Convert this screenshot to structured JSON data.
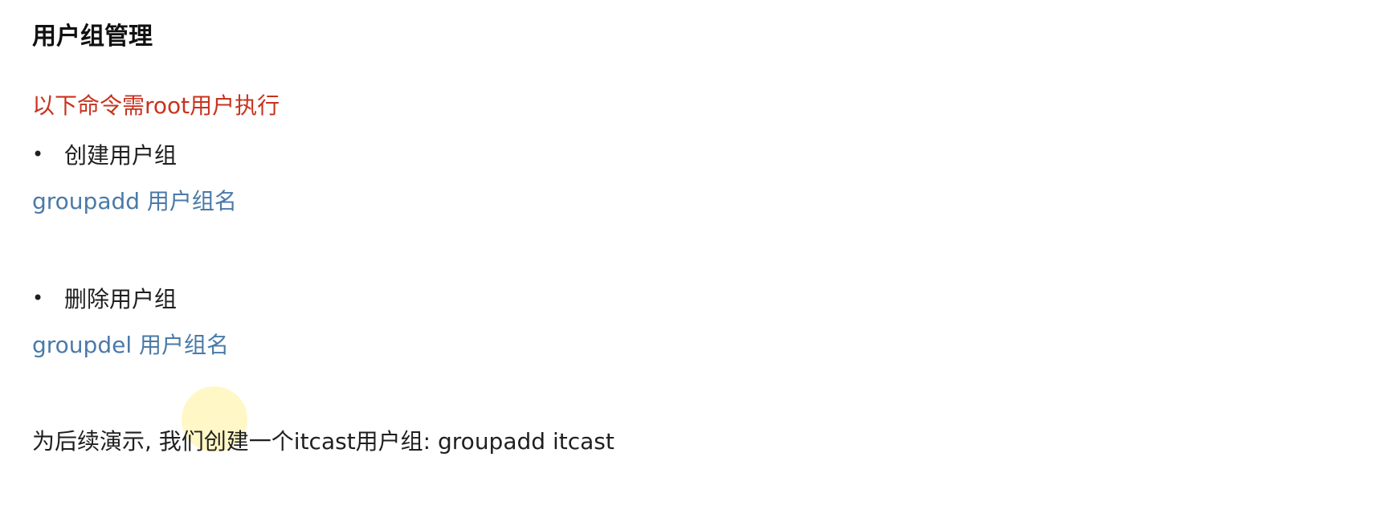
{
  "document": {
    "title": "用户组管理",
    "note": "以下命令需root用户执行",
    "sections": [
      {
        "bullet_icon": "bullet-dot",
        "heading": "创建用户组",
        "command": "groupadd 用户组名"
      },
      {
        "bullet_icon": "bullet-dot",
        "heading": "删除用户组",
        "command": "groupdel 用户组名"
      }
    ],
    "demo_text": "为后续演示, 我们创建一个itcast用户组: groupadd itcast"
  },
  "colors": {
    "note": "#c8331f",
    "command": "#4a7aa8",
    "text": "#1f1f1f",
    "cursor_highlight": "#ffee78"
  },
  "cursor": {
    "icon": "mouse-cursor-highlight"
  }
}
